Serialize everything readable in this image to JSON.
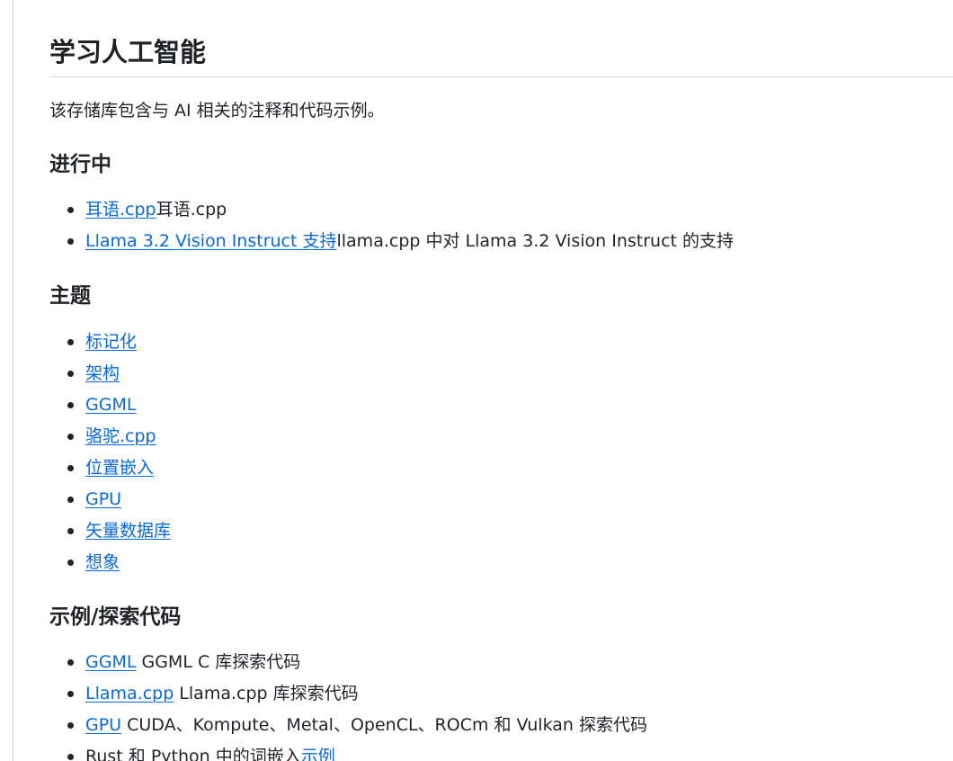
{
  "page": {
    "title": "学习人工智能",
    "intro": "该存储库包含与 AI 相关的注释和代码示例。"
  },
  "sections": [
    {
      "heading": "进行中",
      "items": [
        {
          "link": "耳语.cpp",
          "text": "耳语.cpp"
        },
        {
          "link": "Llama 3.2 Vision Instruct 支持",
          "text": "llama.cpp 中对 Llama 3.2 Vision Instruct 的支持"
        }
      ]
    },
    {
      "heading": "主题",
      "items": [
        {
          "link": "标记化",
          "text": ""
        },
        {
          "link": "架构",
          "text": ""
        },
        {
          "link": "GGML",
          "text": ""
        },
        {
          "link": "骆驼.cpp",
          "text": ""
        },
        {
          "link": "位置嵌入",
          "text": ""
        },
        {
          "link": "GPU",
          "text": ""
        },
        {
          "link": "矢量数据库",
          "text": ""
        },
        {
          "link": "想象",
          "text": ""
        }
      ]
    },
    {
      "heading": "示例/探索代码",
      "items": [
        {
          "link": "GGML",
          "text": " GGML C 库探索代码"
        },
        {
          "link": "Llama.cpp",
          "text": " Llama.cpp 库探索代码"
        },
        {
          "link": "GPU",
          "text": " CUDA、Kompute、Metal、OpenCL、ROCm 和 Vulkan 探索代码"
        },
        {
          "prefix": "Rust 和 Python 中的词嵌入",
          "link": "示例"
        }
      ]
    }
  ]
}
